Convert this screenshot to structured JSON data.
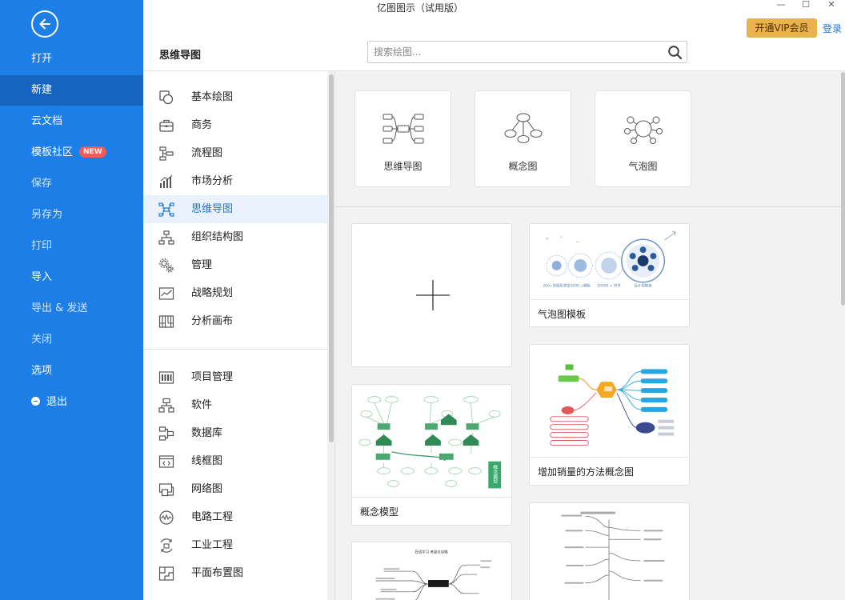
{
  "window": {
    "title": "亿图图示（试用版）",
    "minimize": "—",
    "maximize": "☐",
    "close": "✕"
  },
  "account": {
    "vip_label": "开通VIP会员",
    "login_label": "登录"
  },
  "nav": {
    "items": [
      {
        "label": "打开"
      },
      {
        "label": "新建"
      },
      {
        "label": "云文档"
      },
      {
        "label": "模板社区",
        "badge": "NEW"
      },
      {
        "label": "保存"
      },
      {
        "label": "另存为"
      },
      {
        "label": "打印"
      },
      {
        "label": "导入"
      },
      {
        "label": "导出 & 发送"
      },
      {
        "label": "关闭"
      },
      {
        "label": "选项"
      },
      {
        "label": "退出"
      }
    ]
  },
  "header": {
    "section_title": "思维导图",
    "search_placeholder": "搜索绘图..."
  },
  "categories": {
    "group1": [
      {
        "label": "基本绘图",
        "icon": "shapes-icon"
      },
      {
        "label": "商务",
        "icon": "briefcase-icon"
      },
      {
        "label": "流程图",
        "icon": "flowchart-icon"
      },
      {
        "label": "市场分析",
        "icon": "bar-chart-icon"
      },
      {
        "label": "思维导图",
        "icon": "mindmap-icon"
      },
      {
        "label": "组织结构图",
        "icon": "org-chart-icon"
      },
      {
        "label": "管理",
        "icon": "gears-icon"
      },
      {
        "label": "战略规划",
        "icon": "line-chart-icon"
      },
      {
        "label": "分析画布",
        "icon": "canvas-grid-icon"
      }
    ],
    "group2": [
      {
        "label": "项目管理",
        "icon": "gantt-icon"
      },
      {
        "label": "软件",
        "icon": "software-icon"
      },
      {
        "label": "数据库",
        "icon": "database-icon"
      },
      {
        "label": "线框图",
        "icon": "wireframe-icon"
      },
      {
        "label": "网络图",
        "icon": "network-icon"
      },
      {
        "label": "电路工程",
        "icon": "circuit-icon"
      },
      {
        "label": "工业工程",
        "icon": "industrial-icon"
      },
      {
        "label": "平面布置图",
        "icon": "floorplan-icon"
      }
    ]
  },
  "diagram_types": [
    {
      "label": "思维导图"
    },
    {
      "label": "概念图"
    },
    {
      "label": "气泡图"
    }
  ],
  "templates": {
    "concept_model": {
      "caption": "概念模型",
      "side_label": "概念模型"
    },
    "bubble_template": {
      "caption": "气泡图模板",
      "labels": [
        "200+的图形类型",
        "3000 +模板",
        "20000 + 符号",
        "设计更精美"
      ]
    },
    "sales_concept": {
      "caption": "增加销量的方法概念图"
    },
    "mindmap_preview": {
      "title": "日语学习 考级全攻略"
    }
  }
}
